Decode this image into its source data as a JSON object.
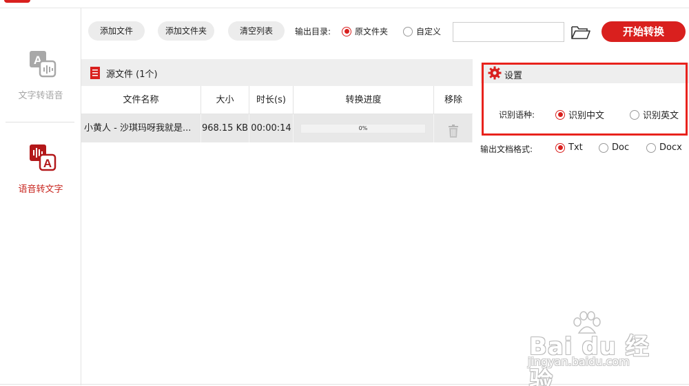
{
  "sidebar": {
    "items": [
      {
        "label": "文字转语音",
        "icon": "text-to-speech-icon",
        "active": false
      },
      {
        "label": "语音转文字",
        "icon": "speech-to-text-icon",
        "active": true
      }
    ]
  },
  "toolbar": {
    "add_file": "添加文件",
    "add_folder": "添加文件夹",
    "clear_list": "清空列表",
    "output_dir_label": "输出目录:",
    "output_options": [
      "原文件夹",
      "自定义"
    ],
    "output_selected": "原文件夹",
    "path_value": "",
    "start": "开始转换"
  },
  "files": {
    "header": "源文件 (1个)",
    "columns": [
      "文件名称",
      "大小",
      "时长(s)",
      "转换进度",
      "移除"
    ],
    "rows": [
      {
        "name": "小黄人 - 沙琪玛呀我就是...",
        "size": "968.15 KB",
        "duration": "00:00:14",
        "progress": 0,
        "progress_label": "0%"
      }
    ]
  },
  "settings": {
    "title": "设置",
    "lang_label": "识别语种:",
    "lang_options": [
      "识别中文",
      "识别英文"
    ],
    "lang_selected": "识别中文",
    "format_label": "输出文档格式:",
    "format_options": [
      "Txt",
      "Doc",
      "Docx"
    ],
    "format_selected": "Txt"
  },
  "watermark": {
    "main": "Bai du 经验",
    "sub": "jingyan.baidu.com"
  },
  "colors": {
    "accent": "#d9201e",
    "highlight_box": "#e8221c"
  }
}
